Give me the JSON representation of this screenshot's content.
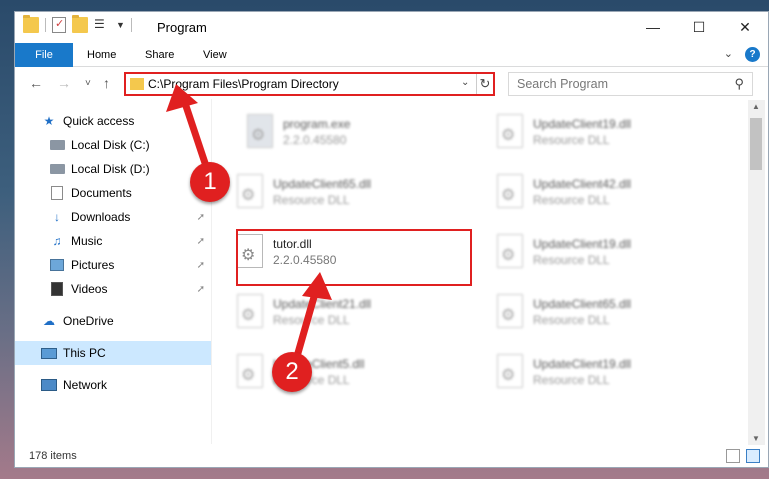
{
  "window": {
    "title": "Program"
  },
  "ribbon": {
    "tabs": [
      "File",
      "Home",
      "Share",
      "View"
    ],
    "help": "?"
  },
  "nav": {
    "back": "←",
    "forward": "→",
    "recent": "˅",
    "up": "↑",
    "address": "C:\\Program Files\\Program Directory",
    "search_placeholder": "Search Program"
  },
  "sidebar": {
    "items": [
      {
        "label": "Quick access",
        "icon": "star-icon",
        "pinned": false
      },
      {
        "label": "Local Disk (C:)",
        "icon": "drive-icon",
        "pinned": false
      },
      {
        "label": "Local Disk (D:)",
        "icon": "drive-icon",
        "pinned": false
      },
      {
        "label": "Documents",
        "icon": "documents-icon",
        "pinned": false
      },
      {
        "label": "Downloads",
        "icon": "download-icon",
        "pinned": true
      },
      {
        "label": "Music",
        "icon": "music-icon",
        "pinned": true
      },
      {
        "label": "Pictures",
        "icon": "pictures-icon",
        "pinned": true
      },
      {
        "label": "Videos",
        "icon": "videos-icon",
        "pinned": true
      },
      {
        "label": "OneDrive",
        "icon": "cloud-icon",
        "pinned": false
      },
      {
        "label": "This PC",
        "icon": "computer-icon",
        "pinned": false
      },
      {
        "label": "Network",
        "icon": "network-icon",
        "pinned": false
      }
    ]
  },
  "files": [
    {
      "name": "program.exe",
      "desc": "2.2.0.45580",
      "type": "exe"
    },
    {
      "name": "UpdateClient19.dll",
      "desc": "Resource DLL",
      "type": "dll"
    },
    {
      "name": "UpdateClient65.dll",
      "desc": "Resource DLL",
      "type": "dll"
    },
    {
      "name": "UpdateClient42.dll",
      "desc": "Resource DLL",
      "type": "dll"
    },
    {
      "name": "tutor.dll",
      "desc": "2.2.0.45580",
      "type": "dll"
    },
    {
      "name": "UpdateClient19.dll",
      "desc": "Resource DLL",
      "type": "dll"
    },
    {
      "name": "UpdateClient21.dll",
      "desc": "Resource DLL",
      "type": "dll"
    },
    {
      "name": "UpdateClient65.dll",
      "desc": "Resource DLL",
      "type": "dll"
    },
    {
      "name": "UpdateClient5.dll",
      "desc": "Resource DLL",
      "type": "dll"
    },
    {
      "name": "UpdateClient19.dll",
      "desc": "Resource DLL",
      "type": "dll"
    }
  ],
  "status": {
    "count": "178 items"
  },
  "annotations": {
    "step1": "1",
    "step2": "2",
    "color": "#e02020"
  }
}
